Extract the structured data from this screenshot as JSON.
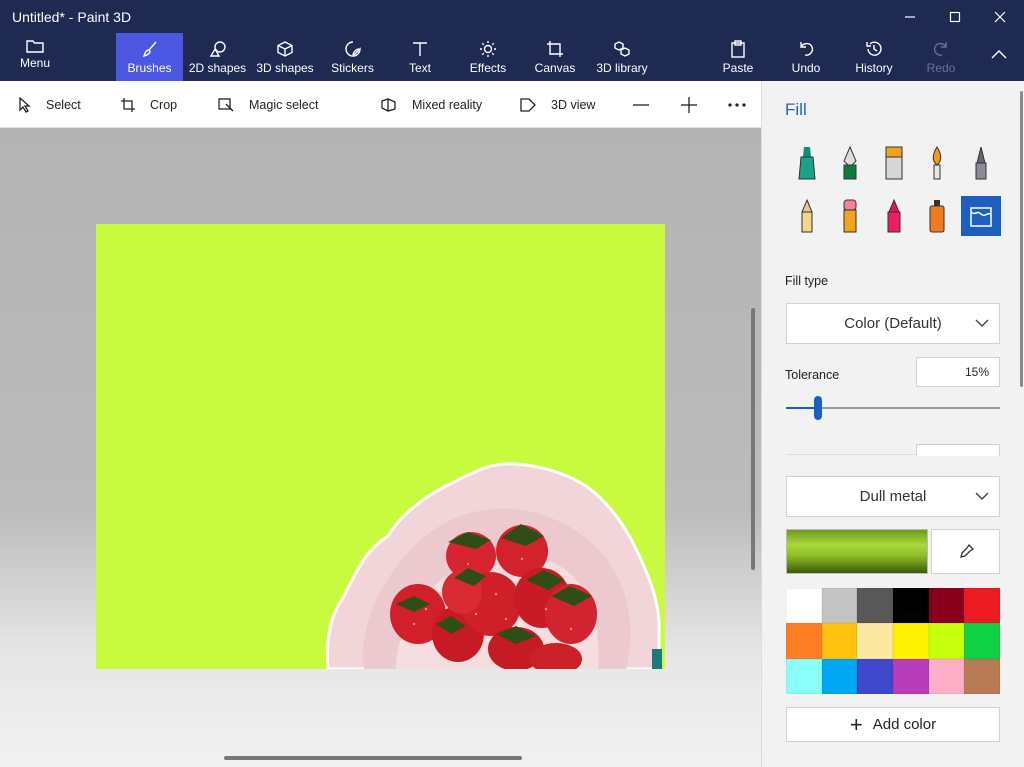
{
  "window": {
    "title": "Untitled* - Paint 3D"
  },
  "ribbon": {
    "menu": "Menu",
    "brushes": "Brushes",
    "shapes2d": "2D shapes",
    "shapes3d": "3D shapes",
    "stickers": "Stickers",
    "text": "Text",
    "effects": "Effects",
    "canvas": "Canvas",
    "library3d": "3D library",
    "paste": "Paste",
    "undo": "Undo",
    "history": "History",
    "redo": "Redo"
  },
  "toolbar": {
    "select": "Select",
    "crop": "Crop",
    "magic_select": "Magic select",
    "mixed_reality": "Mixed reality",
    "view3d": "3D view"
  },
  "panel": {
    "title": "Fill",
    "brushes": [
      {
        "name": "marker",
        "icon": "marker-icon"
      },
      {
        "name": "calligraphy pen",
        "icon": "calligraphy-pen-icon"
      },
      {
        "name": "oil brush",
        "icon": "oil-brush-icon"
      },
      {
        "name": "watercolor",
        "icon": "watercolor-icon"
      },
      {
        "name": "pixel pen",
        "icon": "pixel-pen-icon"
      },
      {
        "name": "pencil",
        "icon": "pencil-icon"
      },
      {
        "name": "eraser",
        "icon": "eraser-icon"
      },
      {
        "name": "crayon",
        "icon": "crayon-icon"
      },
      {
        "name": "spray can",
        "icon": "spray-can-icon"
      },
      {
        "name": "fill",
        "icon": "fill-bucket-icon",
        "selected": true
      }
    ],
    "fill_type_label": "Fill type",
    "fill_type_value": "Color (Default)",
    "tolerance_label": "Tolerance",
    "tolerance_value": "15%",
    "tolerance_fraction": 0.15,
    "material_value": "Dull metal",
    "current_color": "#8cbd24",
    "palette": [
      "#ffffff",
      "#c3c3c3",
      "#585858",
      "#000000",
      "#88001b",
      "#ec1c24",
      "#ff7f27",
      "#ffc20e",
      "#fde8a1",
      "#fff200",
      "#c4ff0e",
      "#0ed145",
      "#8cfffb",
      "#00a8f3",
      "#3f48cc",
      "#b83dba",
      "#ffaec8",
      "#b97a56"
    ],
    "add_color": "Add color"
  },
  "canvas": {
    "background": "#c8fb40"
  }
}
